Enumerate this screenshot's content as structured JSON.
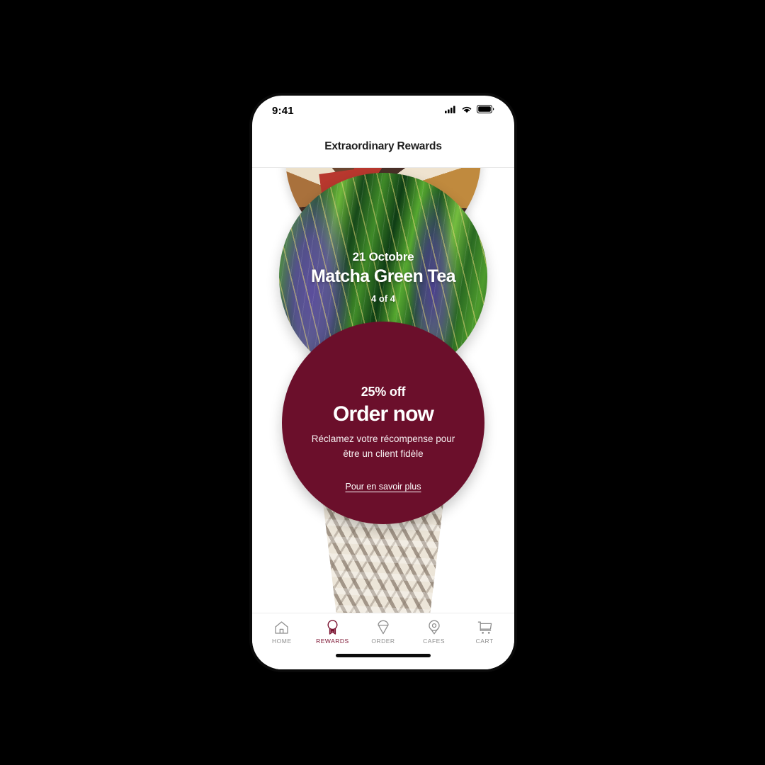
{
  "device": {
    "status_bar": {
      "time": "9:41",
      "icons": [
        "cellular-signal-icon",
        "wifi-icon",
        "battery-icon"
      ]
    },
    "home_indicator": "home-indicator"
  },
  "header": {
    "title": "Extraordinary Rewards"
  },
  "scoops": [
    {
      "id": "top-scoop",
      "style": "geometric-brown",
      "link_label": "Pour en savoir plus"
    },
    {
      "id": "matcha-scoop",
      "style": "green-brushstroke",
      "date": "21 Octobre",
      "name": "Matcha Green Tea",
      "count": "4 of 4",
      "link_label": "Pour en savoir plus"
    },
    {
      "id": "order-scoop",
      "style": "solid-maroon",
      "discount": "25% off",
      "cta": "Order now",
      "description": "Réclamez votre récompense pour être un client fidèle",
      "link_label": "Pour en savoir plus"
    }
  ],
  "cone": {
    "label": "waffle-cone"
  },
  "bottom_nav": {
    "active": "REWARDS",
    "items": [
      {
        "label": "HOME",
        "icon": "home-icon"
      },
      {
        "label": "REWARDS",
        "icon": "award-ribbon-icon"
      },
      {
        "label": "ORDER",
        "icon": "ice-cream-cone-icon"
      },
      {
        "label": "CAFES",
        "icon": "map-pin-icon"
      },
      {
        "label": "CART",
        "icon": "shopping-cart-icon"
      }
    ]
  },
  "colors": {
    "brand_maroon": "#6b0f2b",
    "nav_active": "#7b1230",
    "nav_inactive": "#8e8e8e",
    "screen_background": "#ffffff",
    "page_background": "#000000",
    "cone": "#ece5d8"
  }
}
